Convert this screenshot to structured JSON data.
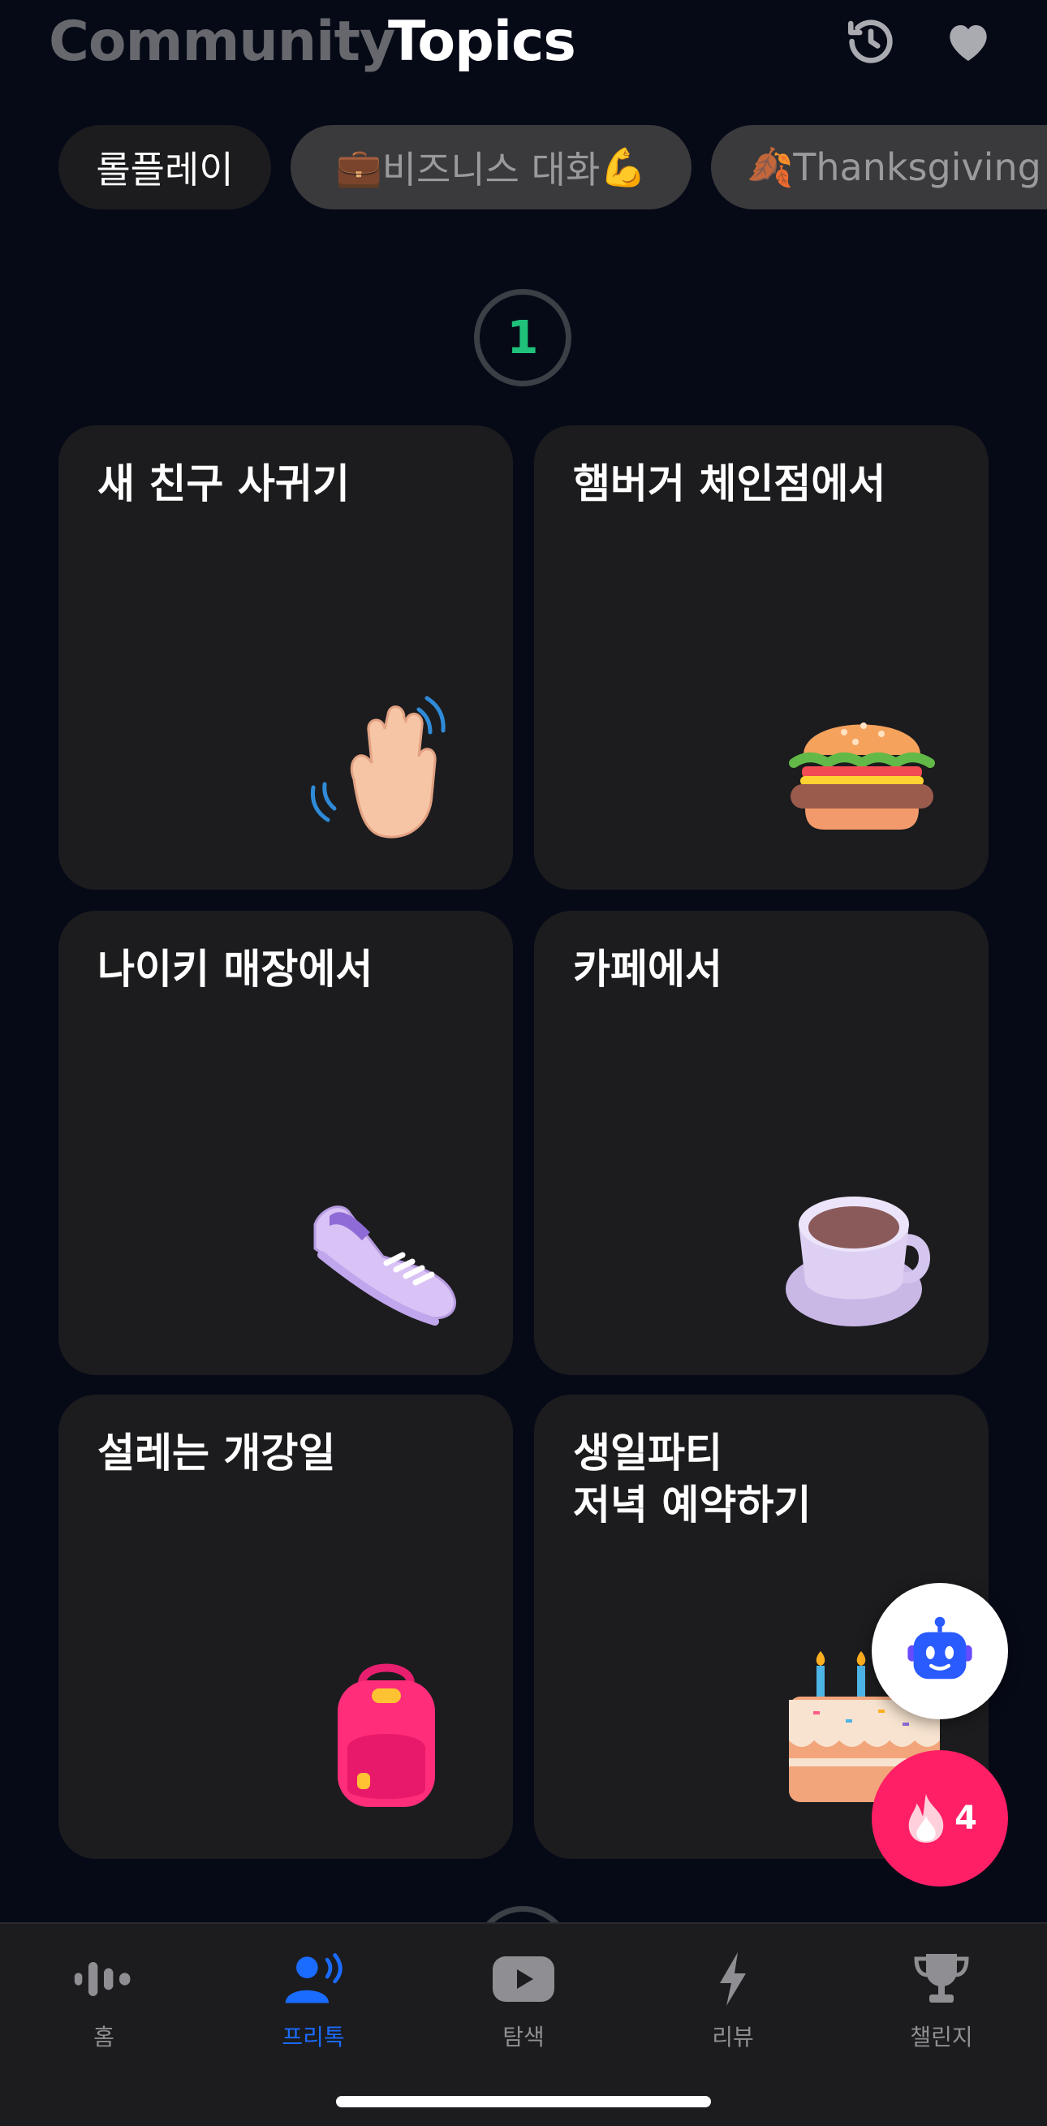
{
  "header": {
    "community_label": "Community",
    "topics_label": "Topics",
    "history_icon": "history-icon",
    "favorites_icon": "heart-icon"
  },
  "chips": [
    {
      "label": "롤플레이",
      "emoji_before": "",
      "emoji_after": ""
    },
    {
      "label": "비즈니스 대화",
      "emoji_before": "💼",
      "emoji_after": "💪"
    },
    {
      "label": "Thanksgiving",
      "emoji_before": "🍂",
      "emoji_after": ""
    }
  ],
  "step": {
    "number": "1"
  },
  "topics": [
    {
      "title": "새 친구 사귀기",
      "icon": "waving-hand-icon"
    },
    {
      "title": "햄버거 체인점에서",
      "icon": "hamburger-icon"
    },
    {
      "title": "나이키 매장에서",
      "icon": "sneaker-icon"
    },
    {
      "title": "카페에서",
      "icon": "coffee-cup-icon"
    },
    {
      "title": "설레는 개강일",
      "icon": "backpack-icon"
    },
    {
      "title": "생일파티\n저녁 예약하기",
      "icon": "birthday-cake-icon"
    }
  ],
  "floating": {
    "bot_icon": "robot-icon",
    "streak_icon": "fire-icon",
    "streak_count": "4"
  },
  "bottom_nav": [
    {
      "label": "홈",
      "icon": "voice-wave-icon",
      "active": false
    },
    {
      "label": "프리톡",
      "icon": "speaking-person-icon",
      "active": true
    },
    {
      "label": "탐색",
      "icon": "play-video-icon",
      "active": false
    },
    {
      "label": "리뷰",
      "icon": "lightning-icon",
      "active": false
    },
    {
      "label": "챌린지",
      "icon": "trophy-icon",
      "active": false
    }
  ],
  "colors": {
    "background": "#060a17",
    "card": "#1c1c1e",
    "accent_blue": "#1a6bff",
    "step_green": "#1fc17b",
    "streak_pink": "#ff1f66"
  }
}
